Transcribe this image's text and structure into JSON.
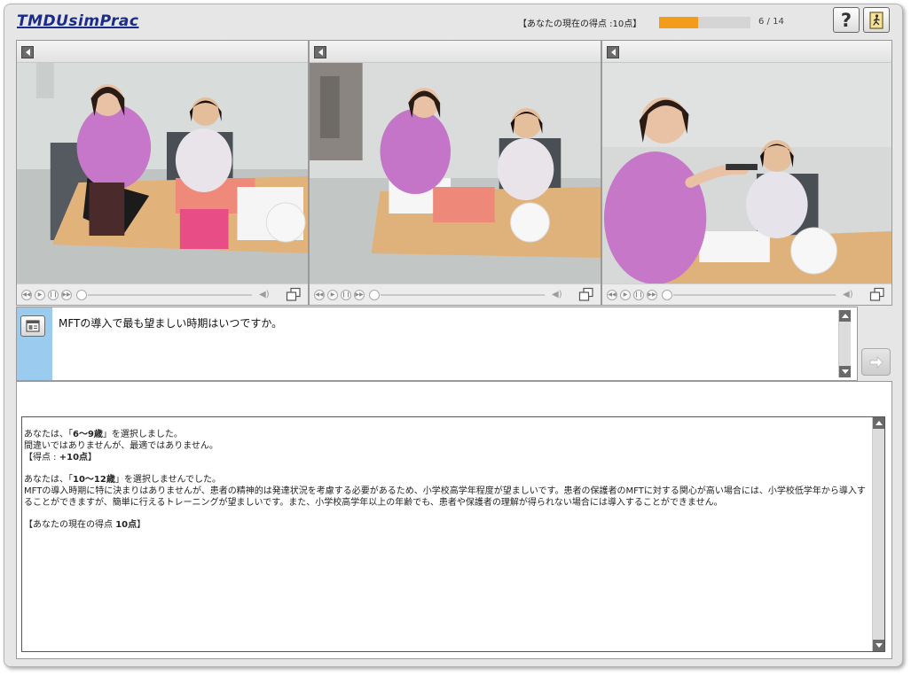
{
  "app": {
    "logo": "TMDUsimPrac"
  },
  "header": {
    "score_label": "【あなたの現在の得点 :10点】",
    "progress": {
      "current": 6,
      "total": 14,
      "text": "6 / 14"
    },
    "help_label": "?"
  },
  "videos": [
    {
      "scene": "hygienist-laptop"
    },
    {
      "scene": "hygienist-pointing"
    },
    {
      "scene": "hygienist-spoon"
    }
  ],
  "question": {
    "text": "MFTの導入で最も望ましい時期はいつですか。"
  },
  "feedback": {
    "lines": [
      {
        "segments": [
          {
            "t": "あなたは、「"
          },
          {
            "t": "6〜9歳",
            "b": true
          },
          {
            "t": "」を選択しました。"
          }
        ]
      },
      {
        "segments": [
          {
            "t": "間違いではありませんが、最適ではありません。"
          }
        ]
      },
      {
        "segments": [
          {
            "t": "【得点 : "
          },
          {
            "t": "+10点",
            "b": true
          },
          {
            "t": "】"
          }
        ]
      },
      {
        "gap": true
      },
      {
        "segments": [
          {
            "t": "あなたは、「"
          },
          {
            "t": "10〜12歳",
            "b": true
          },
          {
            "t": "」を選択しませんでした。"
          }
        ]
      },
      {
        "segments": [
          {
            "t": "MFTの導入時期に特に決まりはありませんが、患者の精神的は発達状況を考慮する必要があるため、小学校高学年程度が望ましいです。患者の保護者のMFTに対する関心が高い場合には、小学校低学年から導入することができますが、簡単に行えるトレーニングが望ましいです。また、小学校高学年以上の年齢でも、患者や保護者の理解が得られない場合には導入することができません。"
          }
        ]
      },
      {
        "gap": true
      },
      {
        "segments": [
          {
            "t": "【あなたの現在の得点 "
          },
          {
            "t": "10点",
            "b": true
          },
          {
            "t": "】"
          }
        ]
      }
    ]
  },
  "colors": {
    "progress_fill": "#f39c1b",
    "progress_track": "#d5d5d5",
    "logo": "#1a2b8a",
    "question_strip": "#9ccbf0",
    "frame_bg": "#e6e6e6"
  },
  "icons": {
    "help": "question-icon",
    "exit": "exit-door-icon",
    "collapse": "chevron-left-icon",
    "fullscreen": "fullscreen-icon",
    "volume": "speaker-icon",
    "question": "document-icon",
    "next": "arrow-right-icon"
  }
}
